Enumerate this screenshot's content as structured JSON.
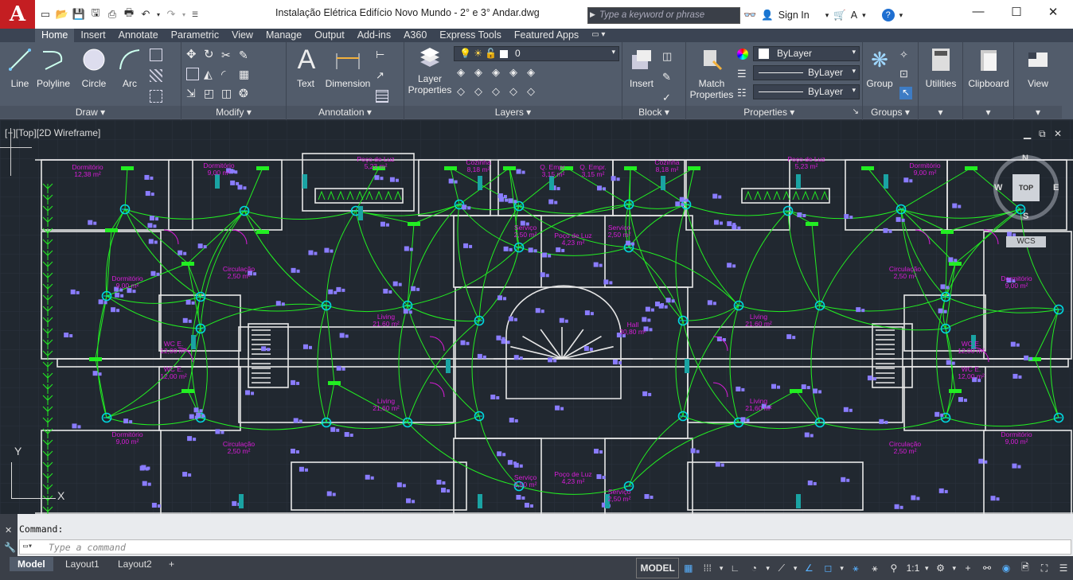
{
  "app": {
    "logo_letter": "A"
  },
  "titlebar": {
    "document_title": "Instalação Elétrica Edifício Novo Mundo - 2° e 3° Andar.dwg",
    "search_placeholder": "Type a keyword or phrase",
    "sign_in": "Sign In"
  },
  "ribbon_tabs": [
    "Home",
    "Insert",
    "Annotate",
    "Parametric",
    "View",
    "Manage",
    "Output",
    "Add-ins",
    "A360",
    "Express Tools",
    "Featured Apps"
  ],
  "ribbon": {
    "draw": {
      "title": "Draw",
      "line": "Line",
      "polyline": "Polyline",
      "circle": "Circle",
      "arc": "Arc"
    },
    "modify": {
      "title": "Modify"
    },
    "annotation": {
      "title": "Annotation",
      "text": "Text",
      "dimension": "Dimension"
    },
    "layers": {
      "title": "Layers",
      "layer_properties": "Layer\nProperties",
      "layer_properties_l1": "Layer",
      "layer_properties_l2": "Properties",
      "current_layer": "0"
    },
    "block": {
      "title": "Block",
      "insert": "Insert"
    },
    "properties": {
      "title": "Properties",
      "match_l1": "Match",
      "match_l2": "Properties",
      "color": "ByLayer",
      "linetype": "ByLayer",
      "lineweight": "ByLayer"
    },
    "groups": {
      "title": "Groups",
      "group": "Group"
    },
    "utilities": "Utilities",
    "clipboard": "Clipboard",
    "view": "View"
  },
  "viewport": {
    "label": "[−][Top][2D Wireframe]",
    "viewcube": {
      "n": "N",
      "s": "S",
      "e": "E",
      "w": "W",
      "top": "TOP",
      "wcs": "WCS"
    },
    "rooms": [
      {
        "name": "Dormitório",
        "area": "12,38 m²"
      },
      {
        "name": "Dormitório",
        "area": "9,00 m²"
      },
      {
        "name": "Poço de Luz",
        "area": "5,23 m²"
      },
      {
        "name": "Cozinha",
        "area": "8,18 m²"
      },
      {
        "name": "Q. Empr.",
        "area": "3,15 m²"
      },
      {
        "name": "Q. Empr.",
        "area": "3,15 m²"
      },
      {
        "name": "Cozinha",
        "area": "8,18 m²"
      },
      {
        "name": "Poço de Luz",
        "area": "5,23 m²"
      },
      {
        "name": "Dormitório",
        "area": "9,00 m²"
      },
      {
        "name": "Dormitório",
        "area": "9,00 m²"
      },
      {
        "name": "Circulação",
        "area": "2,50 m²"
      },
      {
        "name": "Serviço",
        "area": "2,50 m²"
      },
      {
        "name": "Poço de Luz",
        "area": "4,23 m²"
      },
      {
        "name": "Serviço",
        "area": "2,50 m²"
      },
      {
        "name": "Circulação",
        "area": "2,50 m²"
      },
      {
        "name": "Dormitório",
        "area": "9,00 m²"
      },
      {
        "name": "Living",
        "area": "21,60 m²"
      },
      {
        "name": "Hall",
        "area": "30,80 m²"
      },
      {
        "name": "Living",
        "area": "21,60 m²"
      },
      {
        "name": "WC E.",
        "area": "12,00 m²"
      },
      {
        "name": "WC E.",
        "area": "12,00 m²"
      },
      {
        "name": "WC E.",
        "area": "12,00 m²"
      },
      {
        "name": "WC E.",
        "area": "12,00 m²"
      },
      {
        "name": "Living",
        "area": "21,60 m²"
      },
      {
        "name": "Living",
        "area": "21,60 m²"
      },
      {
        "name": "Dormitório",
        "area": "9,00 m²"
      },
      {
        "name": "Circulação",
        "area": "2,50 m²"
      },
      {
        "name": "Serviço",
        "area": "2,50 m²"
      },
      {
        "name": "Poço de Luz",
        "area": "4,23 m²"
      },
      {
        "name": "Serviço",
        "area": "2,50 m²"
      },
      {
        "name": "Circulação",
        "area": "2,50 m²"
      },
      {
        "name": "Dormitório",
        "area": "9,00 m²"
      }
    ],
    "axis_y": "Y",
    "axis_x": "X"
  },
  "command": {
    "history": "Command:",
    "placeholder": "Type a command"
  },
  "layouts": [
    "Model",
    "Layout1",
    "Layout2"
  ],
  "status": {
    "model": "MODEL",
    "scale": "1:1"
  },
  "colors": {
    "accent_blue": "#58b1ff",
    "wire_green": "#22ee22",
    "room_magenta": "#d91cd9",
    "fixture_cyan": "#00d8e0",
    "device_violet": "#8a7cff"
  }
}
